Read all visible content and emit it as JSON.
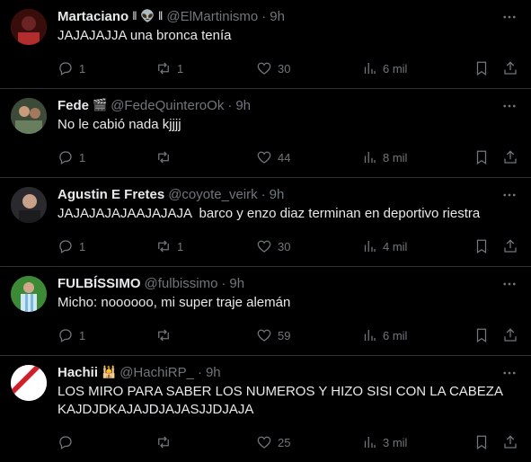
{
  "tweets": [
    {
      "name": "Martaciano",
      "badge": "‖ 👽 ‖",
      "handle": "@ElMartinismo",
      "time": "9h",
      "text": "JAJAJAJJA una bronca tenía",
      "replies": "1",
      "retweets": "1",
      "likes": "30",
      "views": "6 mil",
      "avatar_color": "#8b1c1c"
    },
    {
      "name": "Fede",
      "badge": "🎬",
      "handle": "@FedeQuinteroOk",
      "time": "9h",
      "text": "No le cabió nada kjjjj",
      "replies": "1",
      "retweets": "",
      "likes": "44",
      "views": "8 mil",
      "avatar_color": "#4f5a43"
    },
    {
      "name": "Agustin E Fretes",
      "badge": "",
      "handle": "@coyote_veirk",
      "time": "9h",
      "text": "JAJAJAJAJAAJAJAJA  barco y enzo diaz terminan en deportivo riestra",
      "replies": "1",
      "retweets": "1",
      "likes": "30",
      "views": "4 mil",
      "avatar_color": "#2a2a2e"
    },
    {
      "name": "FULBÍSSIMO",
      "badge": "",
      "handle": "@fulbissimo",
      "time": "9h",
      "text": "Micho: noooooo, mi super traje alemán",
      "replies": "1",
      "retweets": "",
      "likes": "59",
      "views": "6 mil",
      "avatar_color": "#2e6f2b"
    },
    {
      "name": "Hachii",
      "badge": "🕌",
      "handle": "@HachiRP_",
      "time": "9h",
      "text": "LOS MIRO PARA SABER LOS NUMEROS Y HIZO SISI CON LA CABEZA\nKAJDJDKAJAJDJAJASJJDJAJA",
      "replies": "",
      "retweets": "",
      "likes": "25",
      "views": "3 mil",
      "avatar_color": "#ffffff"
    }
  ],
  "icons": {
    "more": "more-options-icon",
    "reply": "reply-icon",
    "retweet": "retweet-icon",
    "like": "like-icon",
    "views": "views-icon",
    "bookmark": "bookmark-icon",
    "share": "share-icon"
  },
  "colors": {
    "background": "#000000",
    "text": "#e7e9ea",
    "muted": "#71767b",
    "divider": "#2f3336"
  }
}
